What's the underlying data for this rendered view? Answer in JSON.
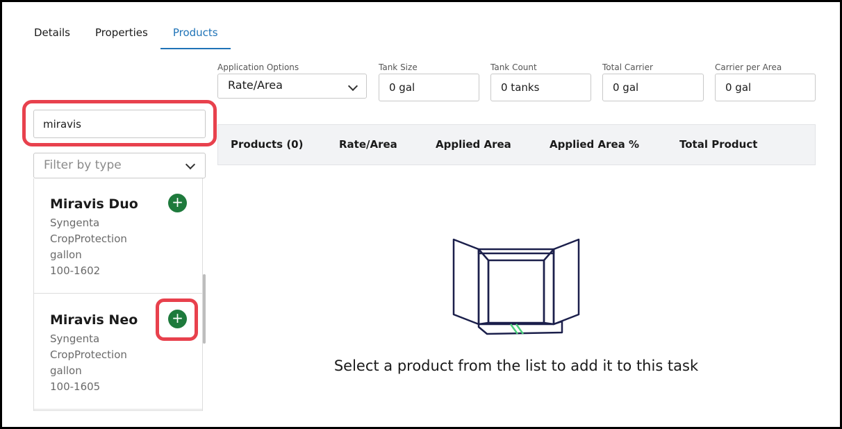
{
  "tabs": [
    {
      "label": "Details"
    },
    {
      "label": "Properties"
    },
    {
      "label": "Products",
      "active": true
    }
  ],
  "fields": {
    "application_options": {
      "label": "Application Options",
      "value": "Rate/Area"
    },
    "tank_size": {
      "label": "Tank Size",
      "value": "0 gal"
    },
    "tank_count": {
      "label": "Tank Count",
      "value": "0 tanks"
    },
    "total_carrier": {
      "label": "Total Carrier",
      "value": "0 gal"
    },
    "carrier_per_area": {
      "label": "Carrier per Area",
      "value": "0 gal"
    }
  },
  "search": {
    "value": "miravis"
  },
  "filter": {
    "placeholder": "Filter by type"
  },
  "products": [
    {
      "name": "Miravis Duo",
      "manufacturer_line1": "Syngenta",
      "manufacturer_line2": "CropProtection",
      "unit": "gallon",
      "code": "100-1602",
      "add_label": "+"
    },
    {
      "name": "Miravis Neo",
      "manufacturer_line1": "Syngenta",
      "manufacturer_line2": "CropProtection",
      "unit": "gallon",
      "code": "100-1605",
      "add_label": "+"
    }
  ],
  "table": {
    "headers": [
      "Products (0)",
      "Rate/Area",
      "Applied Area",
      "Applied Area %",
      "Total Product"
    ]
  },
  "empty_state": {
    "message": "Select a product from the list to add it to this task"
  },
  "colors": {
    "accent_blue": "#1f73b7",
    "add_green": "#1e7a3c",
    "highlight_red": "#e8414d",
    "illustration_navy": "#1b1f4b",
    "illustration_green": "#4cd07d"
  }
}
